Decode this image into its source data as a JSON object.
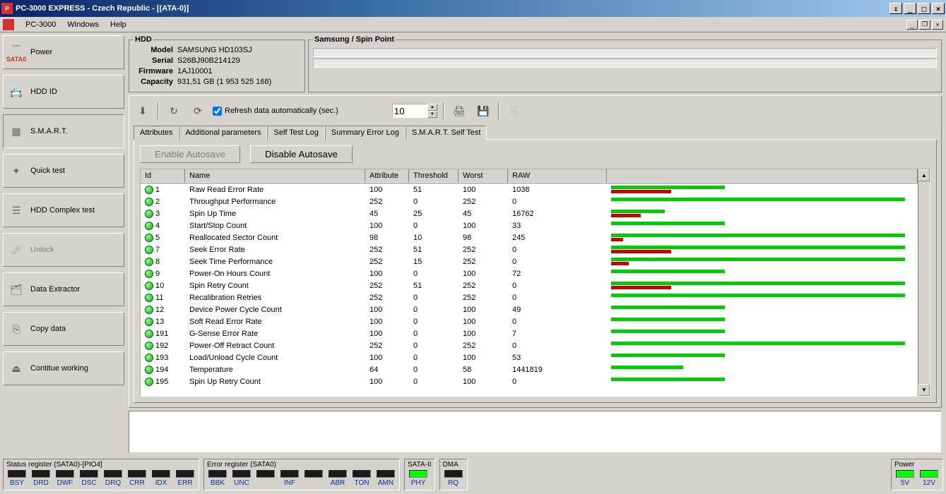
{
  "title": "PC-3000 EXPRESS - Czech Republic - [(ATA-0)]",
  "menubar": {
    "app": "PC-3000",
    "windows": "Windows",
    "help": "Help"
  },
  "sidebar": {
    "power": "Power",
    "sata": "SATA0",
    "hddid": "HDD ID",
    "smart": "S.M.A.R.T.",
    "quicktest": "Quick test",
    "complex": "HDD Complex test",
    "unlock": "Unlock",
    "dataextractor": "Data Extractor",
    "copydata": "Copy data",
    "continue": "Contitue working"
  },
  "hdd": {
    "legend": "HDD",
    "model_l": "Model",
    "model": "SAMSUNG HD103SJ",
    "serial_l": "Serial",
    "serial": "S26BJ90B214129",
    "fw_l": "Firmware",
    "fw": "1AJ10001",
    "cap_l": "Capacity",
    "cap": "931,51 GB (1 953 525 168)"
  },
  "brand": {
    "legend": "Samsung / Spin Point"
  },
  "toolbar": {
    "refresh_chk": "Refresh data automatically (sec.)",
    "interval": "10"
  },
  "tabs": {
    "attr": "Attributes",
    "addl": "Additional parameters",
    "selftest": "Self Test Log",
    "summary": "Summary Error Log",
    "smart_st": "S.M.A.R.T. Self Test"
  },
  "buttons": {
    "enable": "Enable Autosave",
    "disable": "Disable Autosave"
  },
  "columns": {
    "id": "Id",
    "name": "Name",
    "attr": "Attribute",
    "thr": "Threshold",
    "worst": "Worst",
    "raw": "RAW"
  },
  "rows": [
    {
      "id": "1",
      "name": "Raw Read Error Rate",
      "attr": "100",
      "thr": "51",
      "worst": "100",
      "raw": "1038",
      "g": 38,
      "r": 20
    },
    {
      "id": "2",
      "name": "Throughput Performance",
      "attr": "252",
      "thr": "0",
      "worst": "252",
      "raw": "0",
      "g": 98,
      "r": 0
    },
    {
      "id": "3",
      "name": "Spin Up Time",
      "attr": "45",
      "thr": "25",
      "worst": "45",
      "raw": "16762",
      "g": 18,
      "r": 10
    },
    {
      "id": "4",
      "name": "Start/Stop Count",
      "attr": "100",
      "thr": "0",
      "worst": "100",
      "raw": "33",
      "g": 38,
      "r": 0
    },
    {
      "id": "5",
      "name": "Reallocated Sector Count",
      "attr": "98",
      "thr": "10",
      "worst": "98",
      "raw": "245",
      "g": 98,
      "r": 4
    },
    {
      "id": "7",
      "name": "Seek Error Rate",
      "attr": "252",
      "thr": "51",
      "worst": "252",
      "raw": "0",
      "g": 98,
      "r": 20
    },
    {
      "id": "8",
      "name": "Seek Time Performance",
      "attr": "252",
      "thr": "15",
      "worst": "252",
      "raw": "0",
      "g": 98,
      "r": 6
    },
    {
      "id": "9",
      "name": "Power-On Hours Count",
      "attr": "100",
      "thr": "0",
      "worst": "100",
      "raw": "72",
      "g": 38,
      "r": 0
    },
    {
      "id": "10",
      "name": "Spin Retry Count",
      "attr": "252",
      "thr": "51",
      "worst": "252",
      "raw": "0",
      "g": 98,
      "r": 20
    },
    {
      "id": "11",
      "name": "Recalibration Retries",
      "attr": "252",
      "thr": "0",
      "worst": "252",
      "raw": "0",
      "g": 98,
      "r": 0
    },
    {
      "id": "12",
      "name": "Device Power Cycle Count",
      "attr": "100",
      "thr": "0",
      "worst": "100",
      "raw": "49",
      "g": 38,
      "r": 0
    },
    {
      "id": "13",
      "name": "Soft Read Error Rate",
      "attr": "100",
      "thr": "0",
      "worst": "100",
      "raw": "0",
      "g": 38,
      "r": 0
    },
    {
      "id": "191",
      "name": "G-Sense Error Rate",
      "attr": "100",
      "thr": "0",
      "worst": "100",
      "raw": "7",
      "g": 38,
      "r": 0
    },
    {
      "id": "192",
      "name": "Power-Off Retract Count",
      "attr": "252",
      "thr": "0",
      "worst": "252",
      "raw": "0",
      "g": 98,
      "r": 0
    },
    {
      "id": "193",
      "name": "Load/Unload Cycle Count",
      "attr": "100",
      "thr": "0",
      "worst": "100",
      "raw": "53",
      "g": 38,
      "r": 0
    },
    {
      "id": "194",
      "name": "Temperature",
      "attr": "64",
      "thr": "0",
      "worst": "58",
      "raw": "1441819",
      "g": 24,
      "r": 0
    },
    {
      "id": "195",
      "name": "Spin Up Retry Count",
      "attr": "100",
      "thr": "0",
      "worst": "100",
      "raw": "0",
      "g": 38,
      "r": 0
    }
  ],
  "footer": {
    "status_reg": "Status register (SATA0)-[PIO4]",
    "error_reg": "Error register (SATA0)",
    "sata2": "SATA-II",
    "dma": "DMA",
    "power": "Power",
    "status_leds": [
      "BSY",
      "DRD",
      "DWF",
      "DSC",
      "DRQ",
      "CRR",
      "IDX",
      "ERR"
    ],
    "error_leds": [
      "BBK",
      "UNC",
      "",
      "INF",
      "",
      "ABR",
      "TON",
      "AMN"
    ],
    "sata_led": "PHY",
    "dma_led": "RQ",
    "power_leds": [
      "5V",
      "12V"
    ]
  }
}
